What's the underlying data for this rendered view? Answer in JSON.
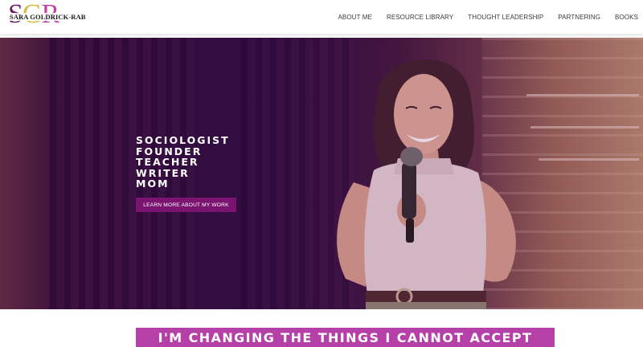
{
  "header": {
    "logo": {
      "letters": [
        "S",
        "G",
        "R"
      ],
      "subtitle": "SARA GOLDRICK-RAB"
    },
    "nav": [
      {
        "label": "ABOUT ME"
      },
      {
        "label": "RESOURCE LIBRARY"
      },
      {
        "label": "THOUGHT LEADERSHIP"
      },
      {
        "label": "PARTNERING"
      },
      {
        "label": "BOOKS"
      }
    ]
  },
  "hero": {
    "roles": [
      "SOCIOLOGIST",
      "FOUNDER",
      "TEACHER",
      "WRITER",
      "MOM"
    ],
    "cta_label": "LEARN MORE ABOUT MY WORK"
  },
  "banner": {
    "text": "I'M CHANGING THE THINGS I CANNOT ACCEPT"
  },
  "colors": {
    "brand_purple": "#7a1470",
    "banner_magenta": "#b540a8",
    "logo_gold": "#d8b93c"
  },
  "icons": {
    "hero_image": "speaker-with-microphone-photo"
  }
}
